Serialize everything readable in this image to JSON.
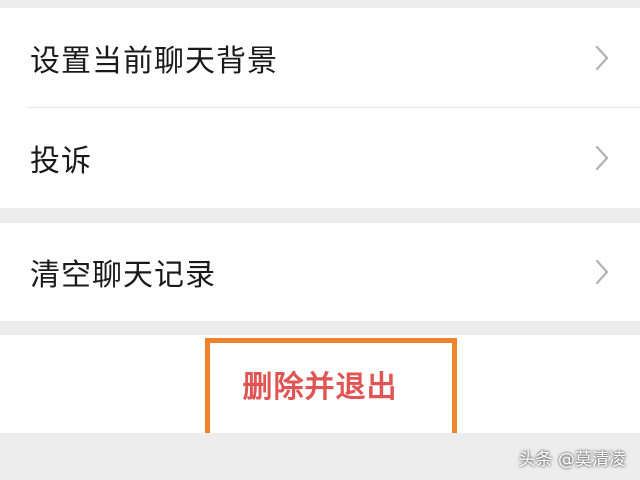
{
  "settings": {
    "items": [
      {
        "label": "设置当前聊天背景"
      },
      {
        "label": "投诉"
      },
      {
        "label": "清空聊天记录"
      }
    ]
  },
  "actions": {
    "delete_exit_label": "删除并退出"
  },
  "watermark": {
    "text": "头条 @莫清凌"
  },
  "colors": {
    "background": "#ededed",
    "row_background": "#ffffff",
    "danger_text": "#e05454",
    "highlight_border": "#f0812d",
    "chevron": "#b2b2b2"
  },
  "icons": {
    "row_chevron": "chevron-right-icon"
  }
}
